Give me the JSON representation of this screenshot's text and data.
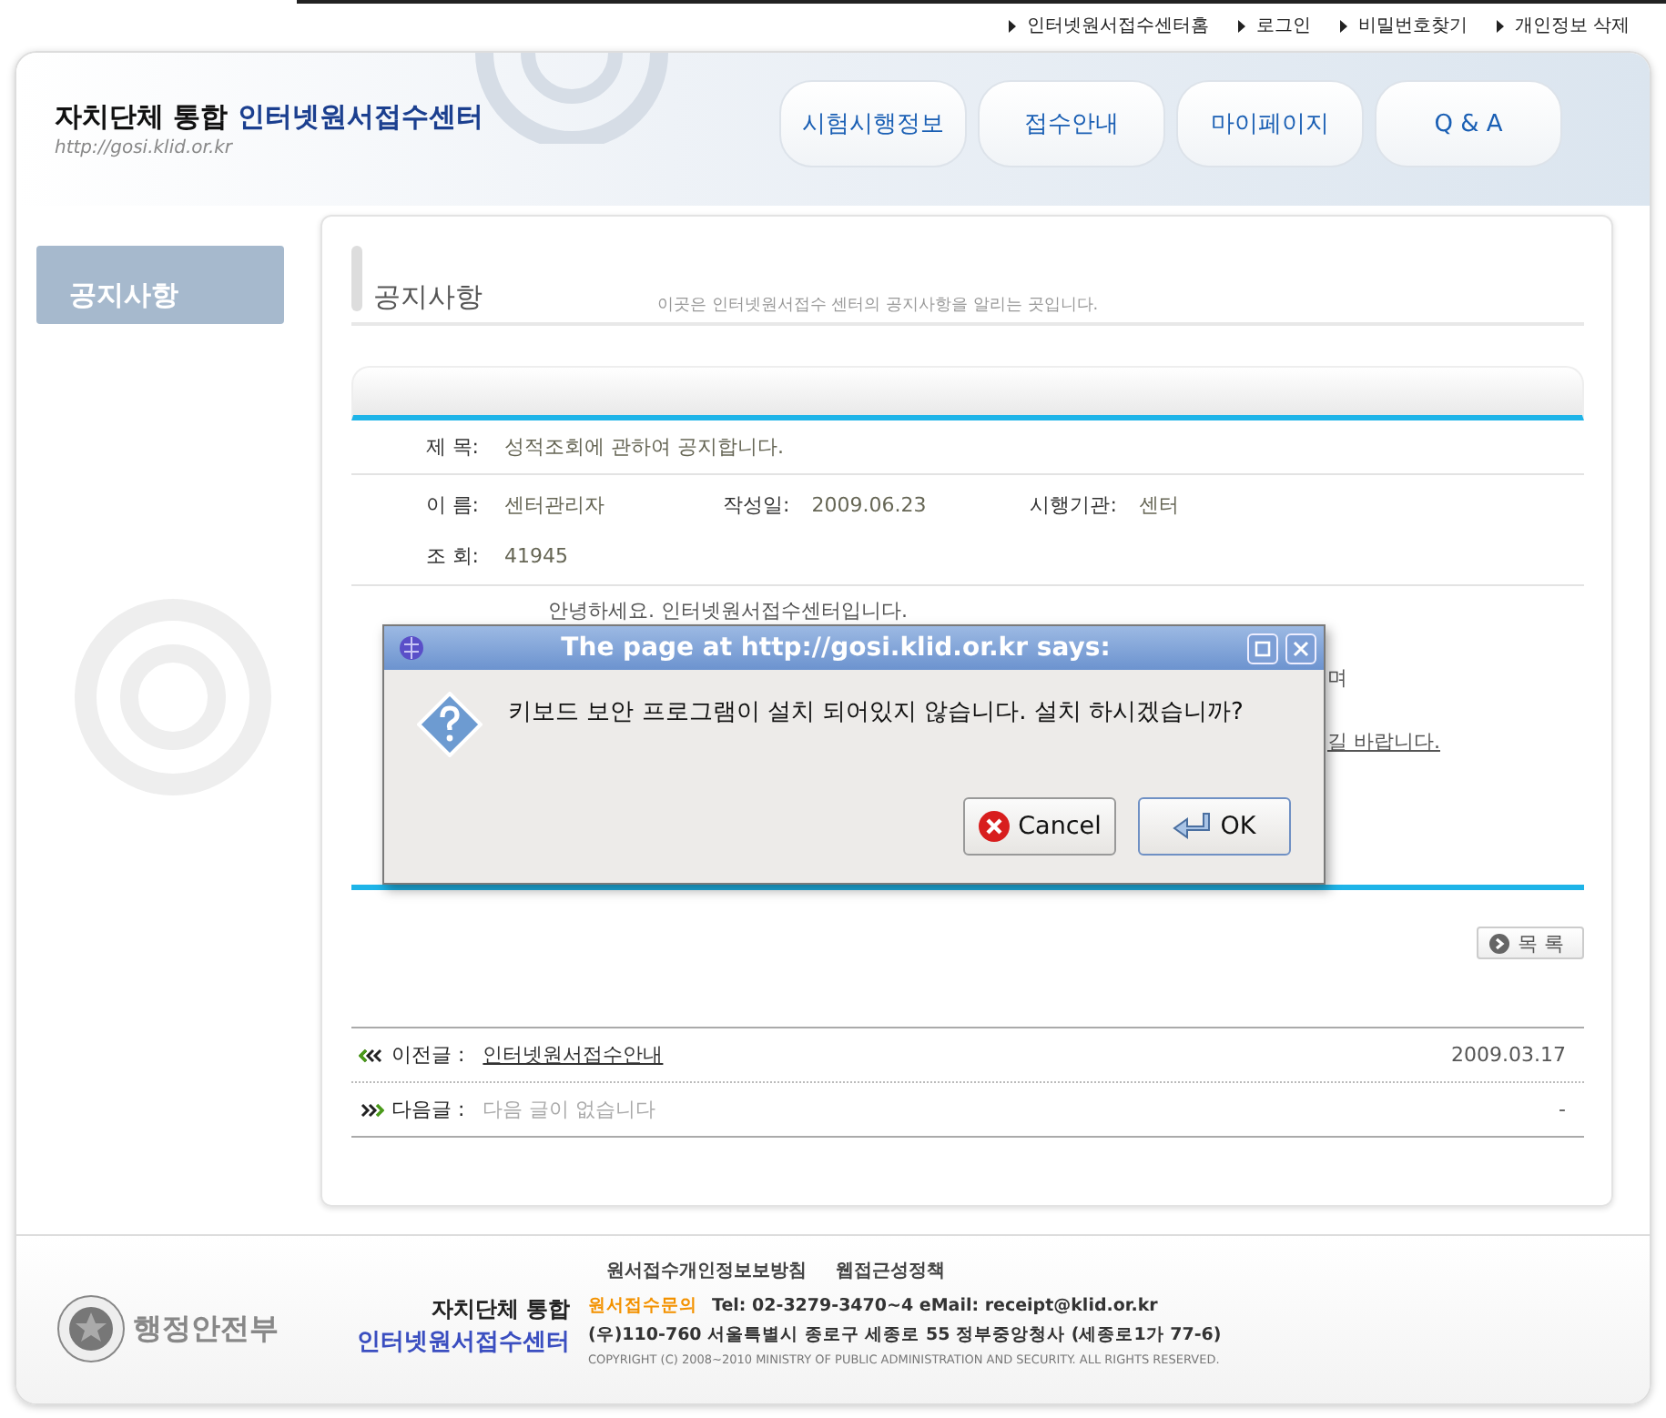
{
  "top_links": [
    "인터넷원서접수센터홈",
    "로그인",
    "비밀번호찾기",
    "개인정보 삭제"
  ],
  "header": {
    "title_prefix": "자치단체 통합",
    "title_main": "인터넷원서접수센터",
    "url": "http://gosi.klid.or.kr"
  },
  "nav": [
    "시험시행정보",
    "접수안내",
    "마이페이지",
    "Q & A"
  ],
  "sidebar": {
    "title": "공지사항"
  },
  "page": {
    "title": "공지사항",
    "description": "이곳은 인터넷원서접수 센터의 공지사항을 알리는 곳입니다."
  },
  "post": {
    "subject_label": "제 목:",
    "subject": "성적조회에 관하여 공지합니다.",
    "name_label": "이 름:",
    "name": "센터관리자",
    "date_label": "작성일:",
    "date": "2009.06.23",
    "agency_label": "시행기관:",
    "agency": "센터",
    "views_label": "조 회:",
    "views": "41945",
    "body": [
      {
        "text": "안녕하세요. 인터넷원서접수센터입니다.",
        "kind": "left"
      },
      {
        "text": "며",
        "kind": "right"
      },
      {
        "text": "길 바랍니다.",
        "kind": "right-link"
      }
    ]
  },
  "list_button": "목 록",
  "prev": {
    "label": "이전글 :",
    "title": "인터넷원서접수안내",
    "date": "2009.03.17"
  },
  "next": {
    "label": "다음글 :",
    "title": "다음 글이 없습니다",
    "date": "-"
  },
  "footer": {
    "links": [
      "원서접수개인정보보방침",
      "웹접근성정책"
    ],
    "ministry": "행정안전부",
    "brand_prefix": "자치단체 통합",
    "brand_main": "인터넷원서접수센터",
    "contact_label": "원서접수문의",
    "contact": "Tel: 02-3279-3470~4  eMail: receipt@klid.or.kr",
    "address": "(우)110-760 서울특별시 종로구 세종로 55 정부중앙청사 (세종로1가 77-6)",
    "copyright": "COPYRIGHT (C) 2008~2010 MINISTRY OF PUBLIC ADMINISTRATION AND SECURITY. ALL RIGHTS RESERVED."
  },
  "dialog": {
    "title": "The page at http://gosi.klid.or.kr says:",
    "message": "키보드 보안 프로그램이 설치 되어있지 않습니다. 설치 하시겠습니까?",
    "buttons": [
      {
        "label": "Cancel",
        "kind": "cancel",
        "selected": false
      },
      {
        "label": "OK",
        "kind": "ok",
        "selected": true
      }
    ]
  }
}
